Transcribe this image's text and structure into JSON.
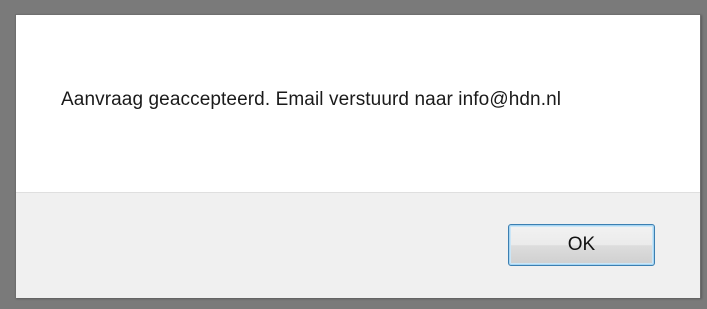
{
  "dialog": {
    "message": "Aanvraag geaccepteerd. Email verstuurd naar info@hdn.nl",
    "ok_label": "OK"
  }
}
